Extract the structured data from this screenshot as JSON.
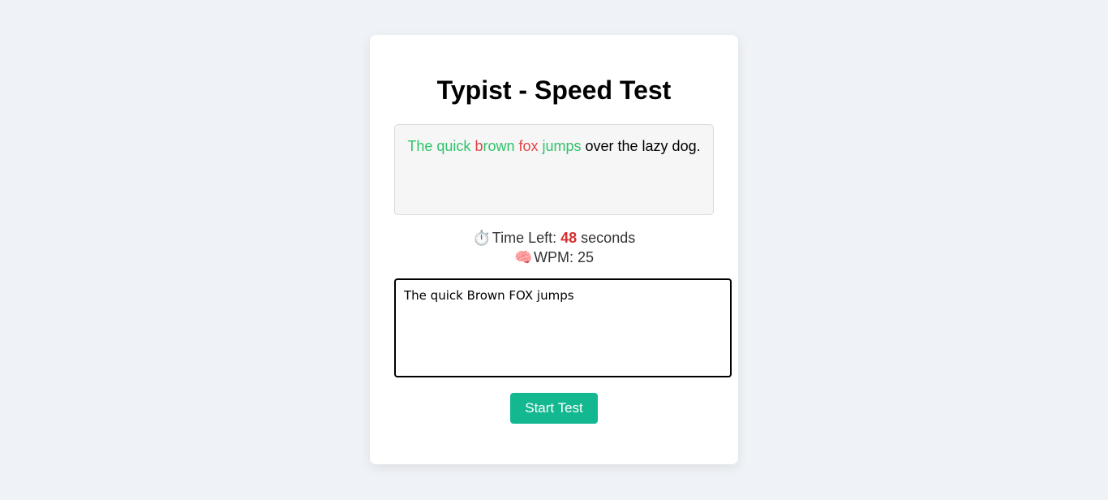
{
  "page": {
    "title": "Typist - Speed Test"
  },
  "passage": {
    "segments": [
      {
        "text": "The quick ",
        "status": "correct"
      },
      {
        "text": "b",
        "status": "incorrect"
      },
      {
        "text": "rown ",
        "status": "correct"
      },
      {
        "text": "fox",
        "status": "incorrect"
      },
      {
        "text": " jumps",
        "status": "correct"
      },
      {
        "text": " over the lazy dog.",
        "status": "pending"
      }
    ]
  },
  "stats": {
    "time_icon": "⏱️",
    "time_label": "Time Left: ",
    "time_value": "48",
    "time_unit": " seconds",
    "wpm_icon": "🧠",
    "wpm_label": "WPM: 25"
  },
  "input": {
    "value": "The quick Brown FOX jumps"
  },
  "button": {
    "label": "Start Test"
  },
  "colors": {
    "correct": "#2ec36a",
    "incorrect": "#e04545",
    "pending": "#000000",
    "time_value": "#d62f2f",
    "button_bg": "#14b890"
  }
}
